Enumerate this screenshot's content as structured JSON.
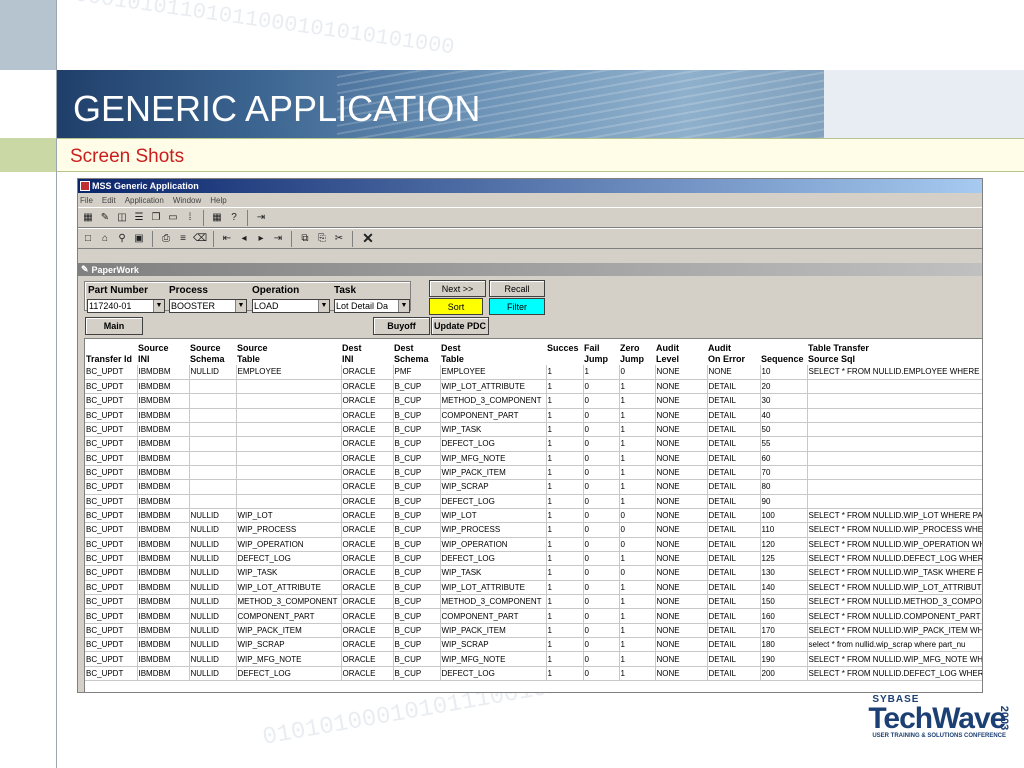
{
  "slide": {
    "title": "GENERIC APPLICATION",
    "subtitle": "Screen Shots",
    "bg_binary_top": "000010101101011000101010101000",
    "bg_binary_bottom": "0101010001010111001010101101"
  },
  "app": {
    "window_title": "MSS Generic Application",
    "menu": [
      "File",
      "Edit",
      "Application",
      "Window",
      "Help"
    ],
    "child_window_title": "PaperWork",
    "form": {
      "labels": {
        "part_number": "Part Number",
        "process": "Process",
        "operation": "Operation",
        "task": "Task"
      },
      "values": {
        "part_number": "117240-01",
        "process": "BOOSTER",
        "operation": "LOAD",
        "task": "Lot Detail Da"
      },
      "buttons": {
        "next": "Next >>",
        "recall": "Recall",
        "sort": "Sort",
        "filter": "Filter",
        "main": "Main",
        "buyoff": "Buyoff",
        "update_pdc": "Update PDC"
      }
    },
    "grid": {
      "columns": [
        [
          "",
          "Transfer Id"
        ],
        [
          "Source",
          "INI"
        ],
        [
          "Source",
          "Schema"
        ],
        [
          "Source",
          "Table"
        ],
        [
          "Dest",
          "INI"
        ],
        [
          "Dest",
          "Schema"
        ],
        [
          "Dest",
          "Table"
        ],
        [
          "Succes",
          ""
        ],
        [
          "Fail",
          "Jump"
        ],
        [
          "Zero",
          "Jump"
        ],
        [
          "Audit",
          "Level"
        ],
        [
          "Audit",
          "On Error"
        ],
        [
          "",
          "Sequence"
        ],
        [
          "Table Transfer",
          "Source Sql"
        ]
      ],
      "rows": [
        [
          "BC_UPDT",
          "IBMDBM",
          "NULLID",
          "EMPLOYEE",
          "ORACLE",
          "PMF",
          "EMPLOYEE",
          "1",
          "1",
          "0",
          "NONE",
          "NONE",
          "10",
          "SELECT * FROM NULLID.EMPLOYEE WHERE E"
        ],
        [
          "BC_UPDT",
          "IBMDBM",
          "",
          "",
          "ORACLE",
          "B_CUP",
          "WIP_LOT_ATTRIBUTE",
          "1",
          "0",
          "1",
          "NONE",
          "DETAIL",
          "20",
          ""
        ],
        [
          "BC_UPDT",
          "IBMDBM",
          "",
          "",
          "ORACLE",
          "B_CUP",
          "METHOD_3_COMPONENT",
          "1",
          "0",
          "1",
          "NONE",
          "DETAIL",
          "30",
          ""
        ],
        [
          "BC_UPDT",
          "IBMDBM",
          "",
          "",
          "ORACLE",
          "B_CUP",
          "COMPONENT_PART",
          "1",
          "0",
          "1",
          "NONE",
          "DETAIL",
          "40",
          ""
        ],
        [
          "BC_UPDT",
          "IBMDBM",
          "",
          "",
          "ORACLE",
          "B_CUP",
          "WIP_TASK",
          "1",
          "0",
          "1",
          "NONE",
          "DETAIL",
          "50",
          ""
        ],
        [
          "BC_UPDT",
          "IBMDBM",
          "",
          "",
          "ORACLE",
          "B_CUP",
          "DEFECT_LOG",
          "1",
          "0",
          "1",
          "NONE",
          "DETAIL",
          "55",
          ""
        ],
        [
          "BC_UPDT",
          "IBMDBM",
          "",
          "",
          "ORACLE",
          "B_CUP",
          "WIP_MFG_NOTE",
          "1",
          "0",
          "1",
          "NONE",
          "DETAIL",
          "60",
          ""
        ],
        [
          "BC_UPDT",
          "IBMDBM",
          "",
          "",
          "ORACLE",
          "B_CUP",
          "WIP_PACK_ITEM",
          "1",
          "0",
          "1",
          "NONE",
          "DETAIL",
          "70",
          ""
        ],
        [
          "BC_UPDT",
          "IBMDBM",
          "",
          "",
          "ORACLE",
          "B_CUP",
          "WIP_SCRAP",
          "1",
          "0",
          "1",
          "NONE",
          "DETAIL",
          "80",
          ""
        ],
        [
          "BC_UPDT",
          "IBMDBM",
          "",
          "",
          "ORACLE",
          "B_CUP",
          "DEFECT_LOG",
          "1",
          "0",
          "1",
          "NONE",
          "DETAIL",
          "90",
          ""
        ],
        [
          "BC_UPDT",
          "IBMDBM",
          "NULLID",
          "WIP_LOT",
          "ORACLE",
          "B_CUP",
          "WIP_LOT",
          "1",
          "0",
          "0",
          "NONE",
          "DETAIL",
          "100",
          "SELECT * FROM NULLID.WIP_LOT WHERE  PA"
        ],
        [
          "BC_UPDT",
          "IBMDBM",
          "NULLID",
          "WIP_PROCESS",
          "ORACLE",
          "B_CUP",
          "WIP_PROCESS",
          "1",
          "0",
          "0",
          "NONE",
          "DETAIL",
          "110",
          "SELECT * FROM NULLID.WIP_PROCESS WHEF"
        ],
        [
          "BC_UPDT",
          "IBMDBM",
          "NULLID",
          "WIP_OPERATION",
          "ORACLE",
          "B_CUP",
          "WIP_OPERATION",
          "1",
          "0",
          "0",
          "NONE",
          "DETAIL",
          "120",
          "SELECT * FROM NULLID.WIP_OPERATION WH"
        ],
        [
          "BC_UPDT",
          "IBMDBM",
          "NULLID",
          "DEFECT_LOG",
          "ORACLE",
          "B_CUP",
          "DEFECT_LOG",
          "1",
          "0",
          "1",
          "NONE",
          "DETAIL",
          "125",
          "SELECT * FROM NULLID.DEFECT_LOG WHERE"
        ],
        [
          "BC_UPDT",
          "IBMDBM",
          "NULLID",
          "WIP_TASK",
          "ORACLE",
          "B_CUP",
          "WIP_TASK",
          "1",
          "0",
          "0",
          "NONE",
          "DETAIL",
          "130",
          "SELECT * FROM NULLID.WIP_TASK WHERE  F"
        ],
        [
          "BC_UPDT",
          "IBMDBM",
          "NULLID",
          "WIP_LOT_ATTRIBUTE",
          "ORACLE",
          "B_CUP",
          "WIP_LOT_ATTRIBUTE",
          "1",
          "0",
          "1",
          "NONE",
          "DETAIL",
          "140",
          "SELECT * FROM NULLID.WIP_LOT_ATTRIBUTE"
        ],
        [
          "BC_UPDT",
          "IBMDBM",
          "NULLID",
          "METHOD_3_COMPONENT",
          "ORACLE",
          "B_CUP",
          "METHOD_3_COMPONENT",
          "1",
          "0",
          "1",
          "NONE",
          "DETAIL",
          "150",
          "SELECT * FROM NULLID.METHOD_3_COMPON"
        ],
        [
          "BC_UPDT",
          "IBMDBM",
          "NULLID",
          "COMPONENT_PART",
          "ORACLE",
          "B_CUP",
          "COMPONENT_PART",
          "1",
          "0",
          "1",
          "NONE",
          "DETAIL",
          "160",
          "SELECT * FROM NULLID.COMPONENT_PART V"
        ],
        [
          "BC_UPDT",
          "IBMDBM",
          "NULLID",
          "WIP_PACK_ITEM",
          "ORACLE",
          "B_CUP",
          "WIP_PACK_ITEM",
          "1",
          "0",
          "1",
          "NONE",
          "DETAIL",
          "170",
          "SELECT * FROM NULLID.WIP_PACK_ITEM WHI"
        ],
        [
          "BC_UPDT",
          "IBMDBM",
          "NULLID",
          "WIP_SCRAP",
          "ORACLE",
          "B_CUP",
          "WIP_SCRAP",
          "1",
          "0",
          "1",
          "NONE",
          "DETAIL",
          "180",
          "select * from nullid.wip_scrap where part_nu"
        ],
        [
          "BC_UPDT",
          "IBMDBM",
          "NULLID",
          "WIP_MFG_NOTE",
          "ORACLE",
          "B_CUP",
          "WIP_MFG_NOTE",
          "1",
          "0",
          "1",
          "NONE",
          "DETAIL",
          "190",
          "SELECT * FROM NULLID.WIP_MFG_NOTE WHE"
        ],
        [
          "BC_UPDT",
          "IBMDBM",
          "NULLID",
          "DEFECT_LOG",
          "ORACLE",
          "B_CUP",
          "DEFECT_LOG",
          "1",
          "0",
          "1",
          "NONE",
          "DETAIL",
          "200",
          "SELECT * FROM NULLID.DEFECT_LOG WHERE"
        ]
      ]
    }
  },
  "logo": {
    "brand": "SYBASE",
    "name": "TechWave",
    "year": "2003",
    "tagline": "USER TRAINING & SOLUTIONS CONFERENCE"
  }
}
